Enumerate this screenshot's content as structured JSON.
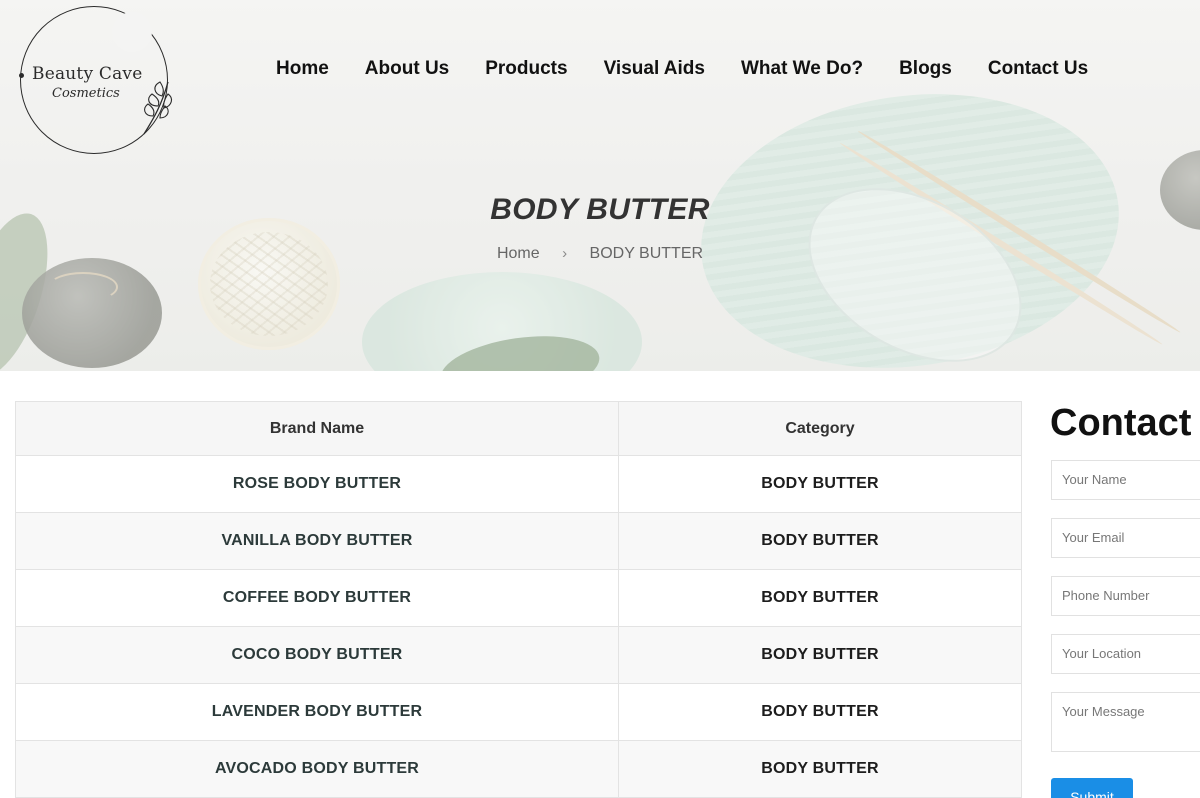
{
  "logo": {
    "title": "Beauty Cave",
    "subtitle": "Cosmetics"
  },
  "nav": {
    "items": [
      "Home",
      "About Us",
      "Products",
      "Visual Aids",
      "What We Do?",
      "Blogs",
      "Contact Us"
    ]
  },
  "hero": {
    "title": "BODY BUTTER",
    "breadcrumb": {
      "home": "Home",
      "separator": "›",
      "current": "BODY BUTTER"
    }
  },
  "table": {
    "headers": [
      "Brand Name",
      "Category"
    ],
    "rows": [
      [
        "ROSE BODY BUTTER",
        "BODY BUTTER"
      ],
      [
        "VANILLA BODY BUTTER",
        "BODY BUTTER"
      ],
      [
        "COFFEE BODY BUTTER",
        "BODY BUTTER"
      ],
      [
        "COCO BODY BUTTER",
        "BODY BUTTER"
      ],
      [
        "LAVENDER BODY BUTTER",
        "BODY BUTTER"
      ],
      [
        "AVOCADO BODY BUTTER",
        "BODY BUTTER"
      ]
    ]
  },
  "contact": {
    "title": "Contact us",
    "name_placeholder": "Your Name",
    "email_placeholder": "Your Email",
    "phone_placeholder": "Phone Number",
    "location_placeholder": "Your Location",
    "message_placeholder": "Your Message",
    "submit_label": "Submit"
  },
  "colors": {
    "submit_button": "#1a8ee6",
    "text_dark": "#111111"
  }
}
